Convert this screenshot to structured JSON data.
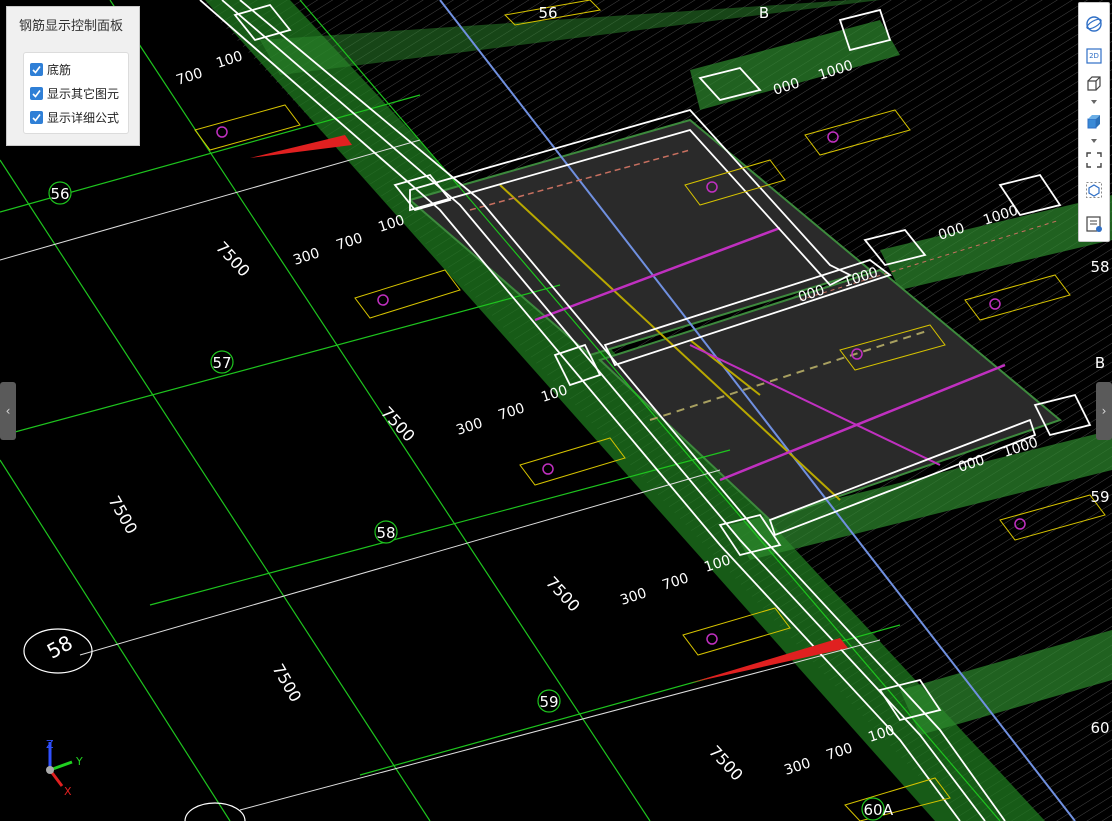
{
  "panel": {
    "title": "钢筋显示控制面板",
    "options": [
      {
        "label": "底筋",
        "checked": true
      },
      {
        "label": "显示其它图元",
        "checked": true
      },
      {
        "label": "显示详细公式",
        "checked": true
      }
    ]
  },
  "grid_axes": {
    "numbered": [
      "56",
      "57",
      "58",
      "59",
      "60",
      "58"
    ],
    "lettered": [
      "B",
      "B",
      "A"
    ]
  },
  "dimensions": {
    "span": "7500",
    "offsets": [
      "300",
      "700",
      "100"
    ],
    "right_offsets": [
      "000",
      "1000"
    ]
  },
  "labels": {
    "b56": "56",
    "b57": "57",
    "b58": "58",
    "b59": "59",
    "b60": "60",
    "big58": "58",
    "right58": "58",
    "right59": "59",
    "right60": "60",
    "topB": "B",
    "rightB": "B",
    "bottomA": "A",
    "partial_b": "56"
  },
  "toolbar": {
    "icons": [
      "orbit-icon",
      "2d-view-icon",
      "3d-box-icon",
      "solid-box-icon",
      "fullscreen-icon",
      "component-view-icon",
      "formula-view-icon"
    ],
    "view2d_label": "2D"
  },
  "axis_triad": {
    "x": "X",
    "y": "Y",
    "z": "Z"
  },
  "colors": {
    "grid_line": "#1ec41e",
    "slab_green": "#2e8a2e",
    "beam_outline": "#ffffff",
    "rebar_magenta": "#c030c0",
    "rebar_yellow": "#b8a800",
    "annotation_yellow": "#d6c300",
    "arrow_red": "#e02020",
    "blue_line": "#7090e0",
    "panel_check": "#2f7fd6"
  }
}
